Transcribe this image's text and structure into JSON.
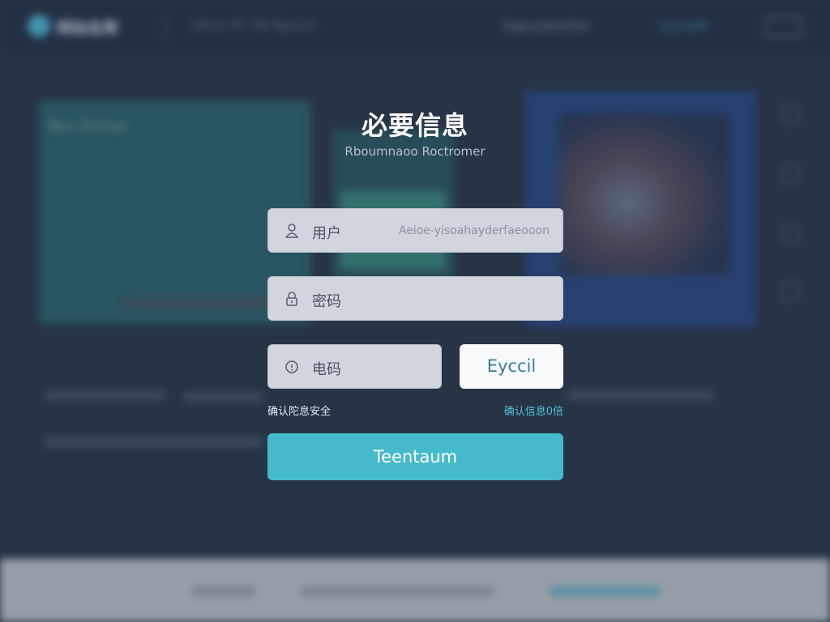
{
  "background": {
    "logo_text": "网站名称",
    "nav_text": "Dhun Pr 38 Nasnn",
    "right_text": "Ogsxuwenker",
    "right_link": "Lscnonl",
    "panel_left_text": "Bsn Pnlinsr"
  },
  "form": {
    "title": "必要信息",
    "subtitle": "Rboumnaoo Roctromer",
    "fields": [
      {
        "label": "用户",
        "icon": "user-icon",
        "hint": "Aeioe-yisoahayderfaeooon"
      },
      {
        "label": "密码",
        "icon": "lock-icon"
      },
      {
        "label": "电码",
        "icon": "info-icon"
      }
    ],
    "code_button": "Eyccil",
    "info_left": "确认陀息安全",
    "info_right": "确认信息0倍",
    "submit_button": "Teentaum"
  },
  "colors": {
    "accent": "#45bacb",
    "background": "#2d3a4d",
    "field_bg": "#d1d5dd",
    "link": "#4fc2d6"
  }
}
